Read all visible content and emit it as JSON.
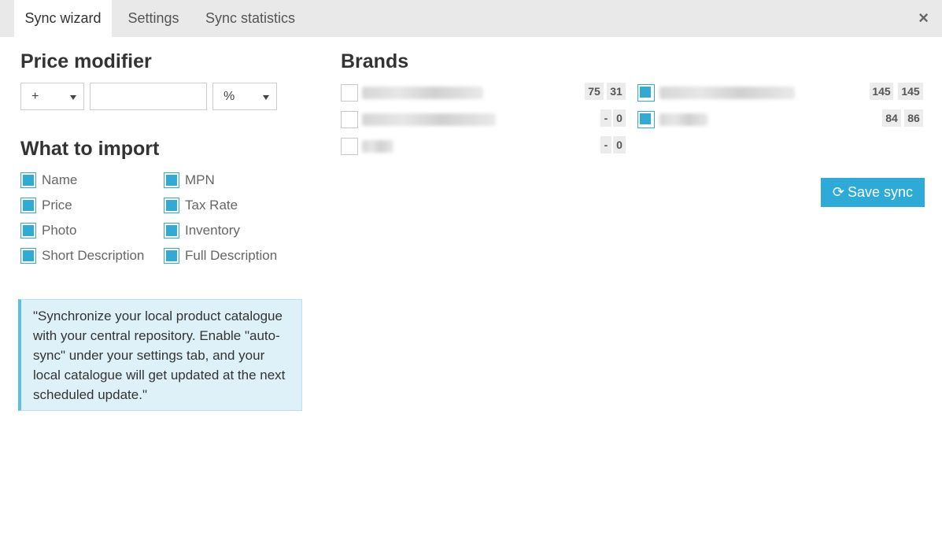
{
  "tabs": [
    "Sync wizard",
    "Settings",
    "Sync statistics"
  ],
  "close_icon": "×",
  "price_modifier": {
    "title": "Price modifier",
    "sign": "+",
    "amount": "",
    "unit": "%"
  },
  "what_to_import": {
    "title": "What to import",
    "left": [
      "Name",
      "Price",
      "Photo",
      "Short Description"
    ],
    "right": [
      "MPN",
      "Tax Rate",
      "Inventory",
      "Full Description"
    ]
  },
  "info_text": "\"Synchronize your local product catalogue with your central repository. Enable \"auto-sync\" under your settings tab, and your local catalogue will get updated at the next scheduled update.\"",
  "brands": {
    "title": "Brands",
    "items": [
      {
        "checked": false,
        "a": "75",
        "b": "31"
      },
      {
        "checked": false,
        "a": "-",
        "b": "0"
      },
      {
        "checked": false,
        "a": "-",
        "b": "0"
      },
      {
        "checked": true,
        "a": "145",
        "b": "145"
      },
      {
        "checked": true,
        "a": "84",
        "b": "86"
      }
    ]
  },
  "save_label": "Save sync",
  "colors": {
    "accent": "#31aad4",
    "info_bg": "#dff1f8"
  }
}
